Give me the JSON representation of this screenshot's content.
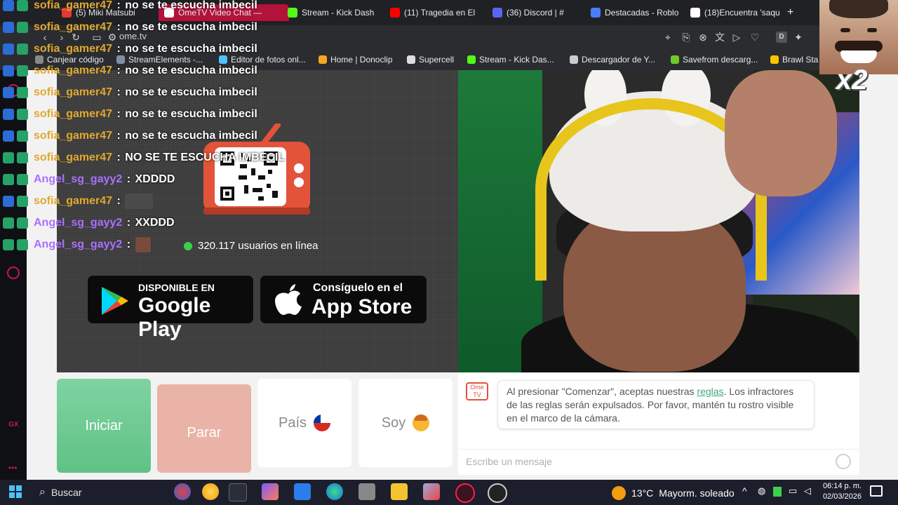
{
  "browser": {
    "tabs": [
      {
        "label": "(5) Miki Matsubi",
        "color": "#e53935"
      },
      {
        "label": "OmeTV Video Chat —",
        "color": "#ffffff",
        "active": true
      },
      {
        "label": "Stream - Kick Dash",
        "color": "#53fc18"
      },
      {
        "label": "(11) Tragedia en El",
        "color": "#ff0000"
      },
      {
        "label": "(36) Discord | #",
        "color": "#5865f2"
      },
      {
        "label": "Destacadas - Roblo",
        "color": "#4a7dff"
      },
      {
        "label": "(18)Encuentra 'saqu",
        "color": "#ffffff"
      }
    ],
    "new_tab": "+",
    "url": "ome.tv",
    "bookmarks": [
      {
        "label": "Canjear código",
        "color": "#888888"
      },
      {
        "label": "StreamElements -...",
        "color": "#7f8fa6"
      },
      {
        "label": "Editor de fotos onl...",
        "color": "#4fc3f7"
      },
      {
        "label": "Home | Donoclip",
        "color": "#f5a623"
      },
      {
        "label": "Supercell",
        "color": "#dddddd"
      },
      {
        "label": "Stream - Kick Das...",
        "color": "#53fc18"
      },
      {
        "label": "Descargador de Y...",
        "color": "#cccccc"
      },
      {
        "label": "Savefrom descarg...",
        "color": "#6ec92b"
      },
      {
        "label": "Brawl Sta",
        "color": "#f7c600"
      }
    ]
  },
  "chat_overlay": [
    {
      "user": "sofia_gamer47",
      "sep": " : ",
      "text": "no se te escucha imbecil",
      "color": "#e0a82e",
      "badge": "b1"
    },
    {
      "user": "sofia_gamer47",
      "sep": " : ",
      "text": "no se te escucha imbecil",
      "color": "#e0a82e",
      "badge": "b1"
    },
    {
      "user": "sofia_gamer47",
      "sep": " : ",
      "text": "no se te escucha imbecil",
      "color": "#e0a82e",
      "badge": "b1"
    },
    {
      "user": "sofia_gamer47",
      "sep": " : ",
      "text": "no se te escucha imbecil",
      "color": "#e0a82e",
      "badge": "b1"
    },
    {
      "user": "sofia_gamer47",
      "sep": " : ",
      "text": "no se te escucha imbecil",
      "color": "#e0a82e",
      "badge": "b1"
    },
    {
      "user": "sofia_gamer47",
      "sep": " : ",
      "text": "no se te escucha imbecil",
      "color": "#e0a82e",
      "badge": "b1"
    },
    {
      "user": "sofia_gamer47",
      "sep": " : ",
      "text": "no se te escucha imbecil",
      "color": "#e0a82e",
      "badge": "b1"
    },
    {
      "user": "sofia_gamer47",
      "sep": " : ",
      "text": "NO SE TE ESCUCHA IMBECIL",
      "color": "#e0a82e",
      "badge": "b2"
    },
    {
      "user": "Angel_sg_gayy2",
      "sep": " : ",
      "text": "XDDDD",
      "color": "#a970ff",
      "badge": "b2"
    },
    {
      "user": "sofia_gamer47",
      "sep": " : ",
      "text": "",
      "color": "#e0a82e",
      "badge": "b1",
      "emote": "wide"
    },
    {
      "user": "Angel_sg_gayy2",
      "sep": " : ",
      "text": "XXDDD",
      "color": "#a970ff",
      "badge": "b2"
    },
    {
      "user": "Angel_sg_gayy2",
      "sep": " : ",
      "text": "",
      "color": "#a970ff",
      "badge": "b2",
      "emote": "small"
    }
  ],
  "ome": {
    "online_count": "320.117 usuarios en línea",
    "google_play": {
      "small": "DISPONIBLE EN",
      "big": "Google Play"
    },
    "app_store": {
      "small": "Consíguelo en el",
      "big": "App Store"
    },
    "buttons": {
      "start": "Iniciar",
      "stop": "Parar",
      "country": "País",
      "soy": "Soy"
    },
    "badge_text": "Ome TV",
    "notice_before": "Al presionar \"Comenzar\", aceptas nuestras ",
    "notice_link": "reglas",
    "notice_after": ". Los infractores de las reglas serán expulsados. Por favor, mantén tu rostro visible en el marco de la cámara.",
    "message_placeholder": "Escribe un mensaje"
  },
  "meme": {
    "multiplier": "x2"
  },
  "taskbar": {
    "search_label": "Buscar",
    "weather": {
      "temp": "13°C",
      "desc": "Mayorm. soleado"
    },
    "time": "06:14 p. m.",
    "date": "02/03/2026"
  }
}
